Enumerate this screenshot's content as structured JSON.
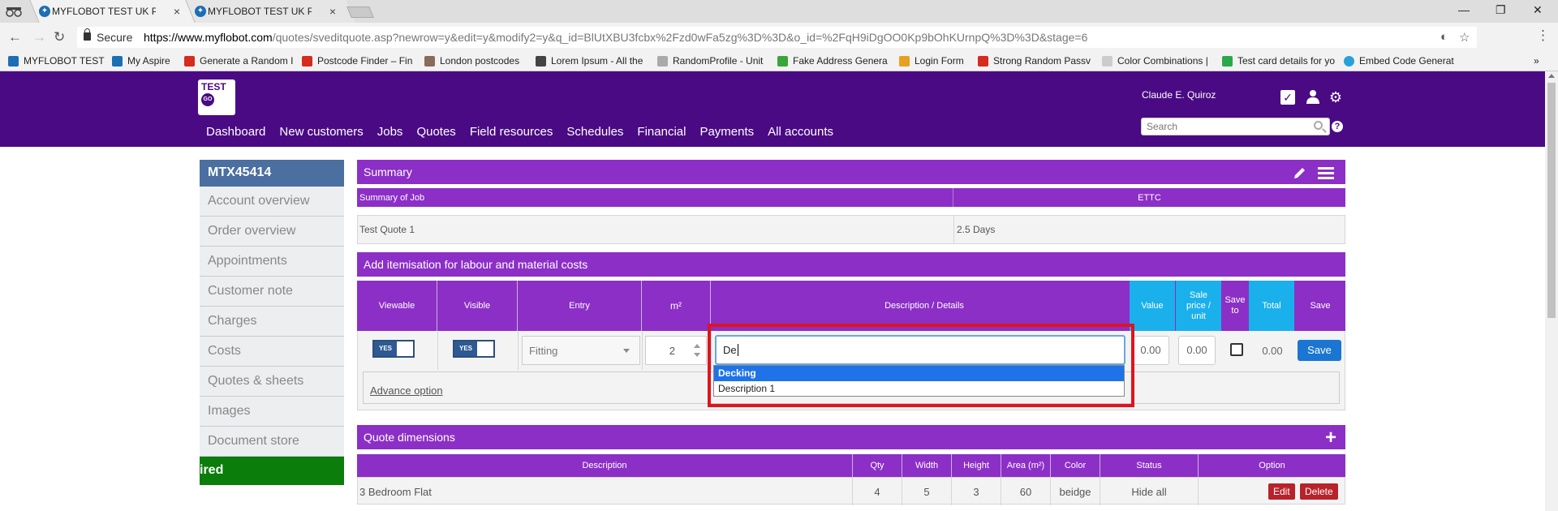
{
  "browser": {
    "tabs": [
      {
        "title": "MYFLOBOT TEST UK POS",
        "active": true
      },
      {
        "title": "MYFLOBOT TEST UK POS",
        "active": false
      }
    ],
    "security_label": "Secure",
    "url_host": "https://www.myflobot.com",
    "url_path": "/quotes/sveditquote.asp?newrow=y&edit=y&modify2=y&q_id=BlUtXBU3fcbx%2Fzd0wFa5zg%3D%3D&o_id=%2FqH9iDgOO0Kp9bOhKUrnpQ%3D%3D&stage=6",
    "bookmarks": [
      {
        "label": "MYFLOBOT TEST",
        "color": "#1b6fb5"
      },
      {
        "label": "My Aspire",
        "color": "#1b6fb5"
      },
      {
        "label": "Generate a Random I",
        "color": "#d62b1f"
      },
      {
        "label": "Postcode Finder – Fin",
        "color": "#d62b1f"
      },
      {
        "label": "London postcodes",
        "color": "#8a6a5a"
      },
      {
        "label": "Lorem Ipsum - All the",
        "color": "#444444"
      },
      {
        "label": "RandomProfile - Unit",
        "color": "#aaaaaa"
      },
      {
        "label": "Fake Address Genera",
        "color": "#3aa53a"
      },
      {
        "label": "Login Form",
        "color": "#e8a020"
      },
      {
        "label": "Strong Random Passv",
        "color": "#d62b1f"
      },
      {
        "label": "Color Combinations |",
        "color": "#cccccc"
      },
      {
        "label": "Test card details for yo",
        "color": "#2aa84a"
      },
      {
        "label": "Embed Code Generat",
        "color": "#29a0d8"
      }
    ],
    "more_bookmarks": "»"
  },
  "header": {
    "logo_text": "TEST",
    "logo_go": "GO",
    "nav": [
      "Dashboard",
      "New customers",
      "Jobs",
      "Quotes",
      "Field resources",
      "Schedules",
      "Financial",
      "Payments",
      "All accounts"
    ],
    "username": "Claude E. Quiroz",
    "search_placeholder": "Search",
    "help": "?"
  },
  "sidebar": {
    "title": "MTX45414",
    "items": [
      "Account overview",
      "Order overview",
      "Appointments",
      "Customer note",
      "Charges",
      "Costs",
      "Quotes & sheets",
      "Images",
      "Document store"
    ],
    "green_label": "ired"
  },
  "summary": {
    "title": "Summary",
    "col1_header": "Summary of Job",
    "col2_header": "ETTC",
    "col1_value": "Test Quote 1",
    "col2_value": "2.5 Days"
  },
  "itemisation": {
    "title": "Add itemisation for labour and material costs",
    "headers": {
      "viewable": "Viewable",
      "visible": "Visible",
      "entry": "Entry",
      "m2": "m²",
      "description": "Description / Details",
      "value": "Value",
      "sale_price": "Sale price / unit",
      "save_to": "Save to",
      "total": "Total",
      "save": "Save"
    },
    "row": {
      "viewable_toggle": "YES",
      "visible_toggle": "YES",
      "entry_selected": "Fitting",
      "m2_value": "2",
      "description_value": "De",
      "value": "0.00",
      "sale_price": "0.00",
      "total": "0.00",
      "save_button": "Save"
    },
    "advance_option": "Advance option",
    "autocomplete": [
      "Decking",
      "Description 1"
    ]
  },
  "dimensions": {
    "title": "Quote dimensions",
    "headers": {
      "description": "Description",
      "qty": "Qty",
      "width": "Width",
      "height": "Height",
      "area": "Area (m²)",
      "color": "Color",
      "status": "Status",
      "option": "Option"
    },
    "rows": [
      {
        "description": "3 Bedroom Flat",
        "qty": "4",
        "width": "5",
        "height": "3",
        "area": "60",
        "color": "beidge",
        "status": "Hide all",
        "edit": "Edit",
        "delete": "Delete"
      }
    ]
  },
  "colors": {
    "header_bg": "#4a0a84",
    "panel_purple": "#8c2fc6",
    "cyan_header": "#1ab0ec",
    "sidebar_title": "#4a6fa0",
    "green": "#0a7d0a",
    "highlight_red": "#e0141e"
  }
}
